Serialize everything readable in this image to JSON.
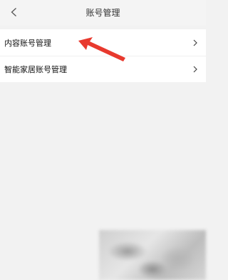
{
  "header": {
    "title": "账号管理",
    "back_icon": "chevron-left-icon"
  },
  "list": {
    "items": [
      {
        "label": "内容账号管理",
        "icon": "chevron-right-icon"
      },
      {
        "label": "智能家居账号管理",
        "icon": "chevron-right-icon"
      }
    ]
  },
  "colors": {
    "background": "#f2f2f2",
    "list_background": "#ffffff",
    "annotation_arrow": "#e8392e"
  }
}
